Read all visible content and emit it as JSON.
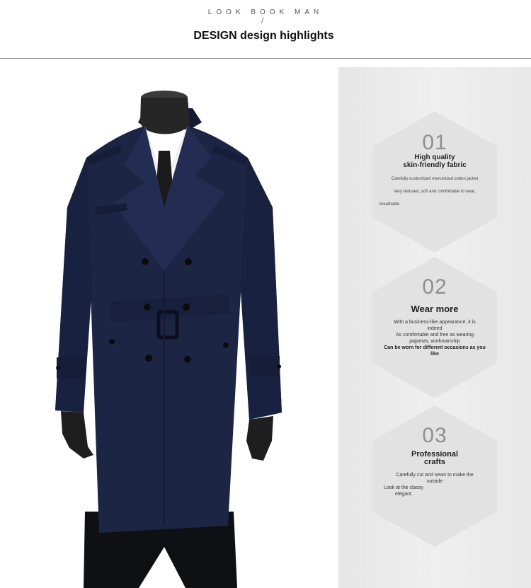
{
  "header": {
    "eyebrow": "LOOK BOOK MAN",
    "slash": "/",
    "title": "DESIGN design highlights"
  },
  "product": {
    "image_icon": "trench-coat-on-mannequin",
    "coat_color": "#1d2545"
  },
  "colors": {
    "panel_bg": "#ebebeb",
    "hexagon": "#e2e2e2",
    "number": "#8f8f8f"
  },
  "highlights": [
    {
      "number": "01",
      "title_line1": "High quality",
      "title_line2": "skin-friendly fabric",
      "line1": "Carefully customized mercerized cotton jacket",
      "line2": "Very textured, soft and comfortable to wear,",
      "line3": "breathable"
    },
    {
      "number": "02",
      "title": "Wear more",
      "line1": "With a business-like appearance, it is",
      "line2": "indeed",
      "line3": "As comfortable and free as wearing",
      "line4": "pajamas, workmanship",
      "line5": "Can be worn for different occasions as you",
      "line6": "like"
    },
    {
      "number": "03",
      "title_line1": "Professional",
      "title_line2": "crafts",
      "line1": "Carefully cut and sewn to make the",
      "line2": "outside",
      "line3": "Look at the classy",
      "line4": "elegant."
    }
  ]
}
